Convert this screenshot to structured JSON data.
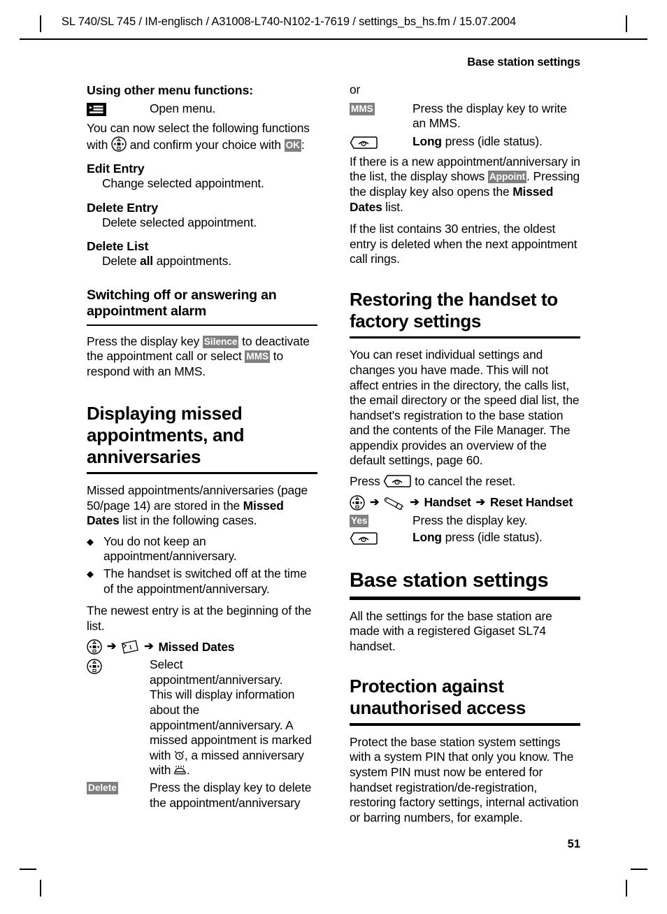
{
  "header": {
    "identifier": "SL 740/SL 745 / IM-englisch / A31008-L740-N102-1-7619 / settings_bs_hs.fm / 15.07.2004"
  },
  "running_title": "Base station settings",
  "folio": "51",
  "colors": {
    "chip_background": "#808080",
    "chip_text": "#ffffff",
    "rule": "#000000",
    "text": "#000000"
  },
  "left_column": {
    "section_menu_functions": {
      "heading": "Using other menu functions:",
      "open_menu_row": {
        "icon": "menu-key-icon",
        "description": "Open menu."
      },
      "intro_part1": "You can now select the following functions with ",
      "intro_icon": "navigation-key-icon",
      "intro_part2": " and confirm your choice with ",
      "intro_chip": "OK",
      "intro_part3": ":",
      "items": [
        {
          "term": "Edit Entry",
          "definition": "Change selected appointment."
        },
        {
          "term": "Delete Entry",
          "definition": "Delete selected appointment."
        },
        {
          "term": "Delete List",
          "definition_prefix": "Delete ",
          "definition_bold": "all",
          "definition_suffix": " appointments."
        }
      ]
    },
    "section_switching_off": {
      "heading": "Switching off or answering an appointment alarm",
      "body_part1": "Press the display key ",
      "body_chip1": "Silence",
      "body_part2": " to deactivate the appointment call or select ",
      "body_chip2": "MMS",
      "body_part3": " to respond with an MMS."
    },
    "section_missed": {
      "heading": "Displaying missed appointments, and anniversaries",
      "intro_part1": "Missed appointments/anniversaries (page 50/page 14) are stored in the ",
      "intro_bold": "Missed Dates",
      "intro_part2": " list in the following cases.",
      "bullets": [
        "You do not keep an appointment/anniversary.",
        "The handset is switched off at the time of the appointment/anniversary."
      ],
      "newest_entry": "The newest entry is at the beginning of the list.",
      "menu_path": {
        "icon1": "navigation-key-icon",
        "arrow1": "➔",
        "icon2": "calendar-icon",
        "arrow2": "➔",
        "label": "Missed Dates"
      },
      "rows": [
        {
          "icon": "navigation-key-icon",
          "description_part1": "Select appointment/anniversary.",
          "description_part2": "This will display information about the appointment/anniversary. A missed appointment is marked with ",
          "icon_alarm": "alarm-clock-icon",
          "description_part3": ", a missed anniversary with ",
          "icon_cake": "birthday-cake-icon",
          "description_part4": "."
        },
        {
          "chip": "Delete",
          "description": "Press the display key to delete the appointment/anniversary"
        }
      ]
    }
  },
  "right_column": {
    "or_label": "or",
    "mms_row": {
      "chip": "MMS",
      "description": "Press the display key to write an MMS."
    },
    "end_key_row": {
      "icon": "end-call-key-icon",
      "description_bold": "Long",
      "description": " press (idle status)."
    },
    "appointment_note": {
      "part1": "If there is a new appointment/anniversary in the list, the display shows ",
      "chip": "Appoint",
      "part2": ". Pressing the display key also opens the ",
      "bold": "Missed Dates",
      "part3": " list."
    },
    "list_limit_note": "If the list contains 30 entries, the oldest entry is deleted when the next appointment call rings.",
    "section_restoring": {
      "heading": "Restoring the handset to factory settings",
      "body": "You can reset individual settings and changes you have made. This will not affect entries in the directory, the calls list, the email directory or the speed dial list, the handset's registration to the base station and the contents of the File Manager. The appendix provides an overview of the default settings, page 60.",
      "cancel_part1": "Press ",
      "cancel_icon": "end-call-key-icon",
      "cancel_part2": " to cancel the reset.",
      "menu_path": {
        "icon1": "navigation-key-icon",
        "arrow1": "➔",
        "icon2": "wrench-settings-icon",
        "arrow2": "➔",
        "label1": "Handset",
        "arrow3": "➔",
        "label2": "Reset Handset"
      },
      "rows": [
        {
          "chip": "Yes",
          "description": "Press the display key."
        },
        {
          "icon": "end-call-key-icon",
          "description_bold": "Long",
          "description": " press (idle status)."
        }
      ]
    },
    "section_base_station": {
      "heading": "Base station settings",
      "body": "All the settings for the base station are made with a registered Gigaset SL74 handset."
    },
    "section_protection": {
      "heading": "Protection against unauthorised access",
      "body": "Protect the base station system settings with a system PIN that only you know. The system PIN must now be entered for handset registration/de-registration, restoring factory settings, internal activation or barring numbers, for example."
    }
  }
}
